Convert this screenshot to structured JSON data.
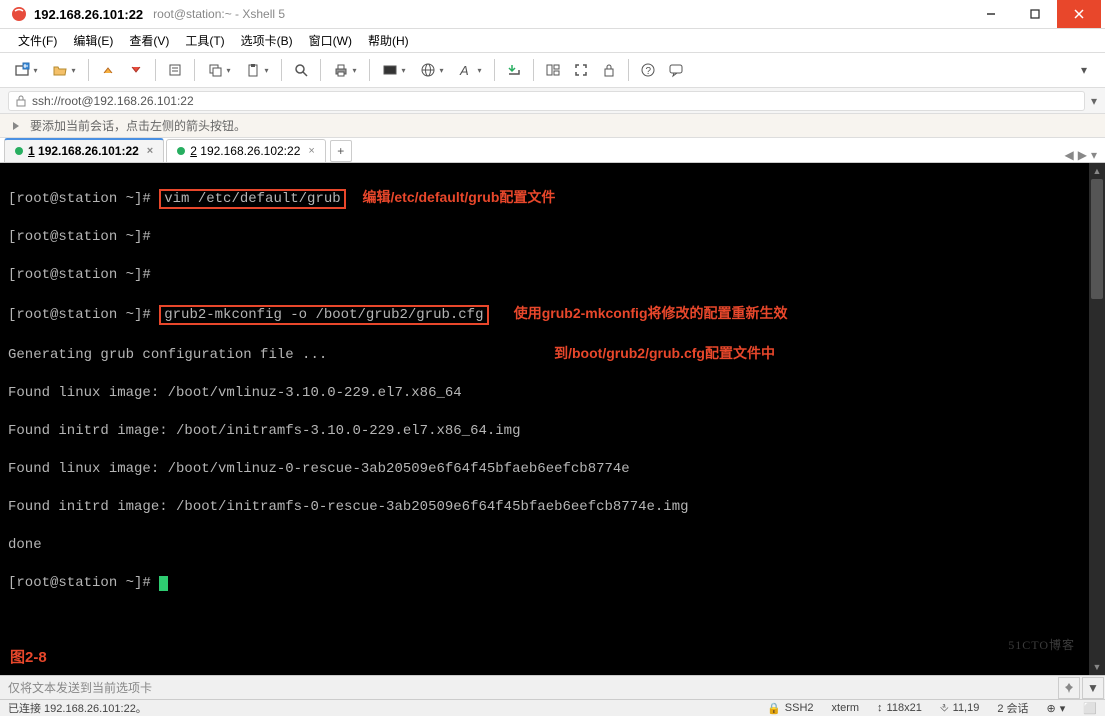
{
  "window": {
    "title_bold": "192.168.26.101:22",
    "title_rest": "root@station:~ - Xshell 5"
  },
  "menu": {
    "file": "文件(F)",
    "edit": "编辑(E)",
    "view": "查看(V)",
    "tools": "工具(T)",
    "tabs": "选项卡(B)",
    "window": "窗口(W)",
    "help": "帮助(H)"
  },
  "address": {
    "url": "ssh://root@192.168.26.101:22"
  },
  "hint": {
    "text": "要添加当前会话，点击左侧的箭头按钮。"
  },
  "tabs": [
    {
      "index": "1",
      "label": "192.168.26.101:22",
      "active": true
    },
    {
      "index": "2",
      "label": "192.168.26.102:22",
      "active": false
    }
  ],
  "terminal": {
    "prompt": "[root@station ~]#",
    "cmd1": "vim /etc/default/grub",
    "annot1": "编辑/etc/default/grub配置文件",
    "cmd2": "grub2-mkconfig -o /boot/grub2/grub.cfg",
    "annot2a": "使用grub2-mkconfig将修改的配置重新生效",
    "annot2b": "到/boot/grub2/grub.cfg配置文件中",
    "out1": "Generating grub configuration file ...",
    "out2": "Found linux image: /boot/vmlinuz-3.10.0-229.el7.x86_64",
    "out3": "Found initrd image: /boot/initramfs-3.10.0-229.el7.x86_64.img",
    "out4": "Found linux image: /boot/vmlinuz-0-rescue-3ab20509e6f64f45bfaeb6eefcb8774e",
    "out5": "Found initrd image: /boot/initramfs-0-rescue-3ab20509e6f64f45bfaeb6eefcb8774e.img",
    "out6": "done",
    "figlabel": "图2-8",
    "watermark": "51CTO博客"
  },
  "sendbar": {
    "placeholder": "仅将文本发送到当前选项卡"
  },
  "status": {
    "conn": "已连接 192.168.26.101:22。",
    "proto": "SSH2",
    "term": "xterm",
    "size": "118x21",
    "pos": "11,19",
    "sess": "2 会话"
  }
}
